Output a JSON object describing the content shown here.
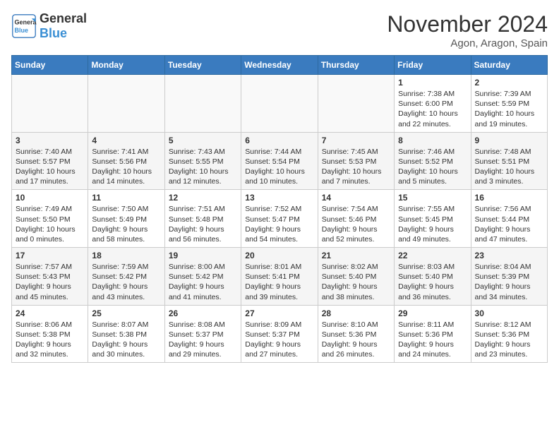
{
  "header": {
    "logo_line1": "General",
    "logo_line2": "Blue",
    "month": "November 2024",
    "location": "Agon, Aragon, Spain"
  },
  "weekdays": [
    "Sunday",
    "Monday",
    "Tuesday",
    "Wednesday",
    "Thursday",
    "Friday",
    "Saturday"
  ],
  "weeks": [
    [
      {
        "day": "",
        "content": ""
      },
      {
        "day": "",
        "content": ""
      },
      {
        "day": "",
        "content": ""
      },
      {
        "day": "",
        "content": ""
      },
      {
        "day": "",
        "content": ""
      },
      {
        "day": "1",
        "content": "Sunrise: 7:38 AM\nSunset: 6:00 PM\nDaylight: 10 hours and 22 minutes."
      },
      {
        "day": "2",
        "content": "Sunrise: 7:39 AM\nSunset: 5:59 PM\nDaylight: 10 hours and 19 minutes."
      }
    ],
    [
      {
        "day": "3",
        "content": "Sunrise: 7:40 AM\nSunset: 5:57 PM\nDaylight: 10 hours and 17 minutes."
      },
      {
        "day": "4",
        "content": "Sunrise: 7:41 AM\nSunset: 5:56 PM\nDaylight: 10 hours and 14 minutes."
      },
      {
        "day": "5",
        "content": "Sunrise: 7:43 AM\nSunset: 5:55 PM\nDaylight: 10 hours and 12 minutes."
      },
      {
        "day": "6",
        "content": "Sunrise: 7:44 AM\nSunset: 5:54 PM\nDaylight: 10 hours and 10 minutes."
      },
      {
        "day": "7",
        "content": "Sunrise: 7:45 AM\nSunset: 5:53 PM\nDaylight: 10 hours and 7 minutes."
      },
      {
        "day": "8",
        "content": "Sunrise: 7:46 AM\nSunset: 5:52 PM\nDaylight: 10 hours and 5 minutes."
      },
      {
        "day": "9",
        "content": "Sunrise: 7:48 AM\nSunset: 5:51 PM\nDaylight: 10 hours and 3 minutes."
      }
    ],
    [
      {
        "day": "10",
        "content": "Sunrise: 7:49 AM\nSunset: 5:50 PM\nDaylight: 10 hours and 0 minutes."
      },
      {
        "day": "11",
        "content": "Sunrise: 7:50 AM\nSunset: 5:49 PM\nDaylight: 9 hours and 58 minutes."
      },
      {
        "day": "12",
        "content": "Sunrise: 7:51 AM\nSunset: 5:48 PM\nDaylight: 9 hours and 56 minutes."
      },
      {
        "day": "13",
        "content": "Sunrise: 7:52 AM\nSunset: 5:47 PM\nDaylight: 9 hours and 54 minutes."
      },
      {
        "day": "14",
        "content": "Sunrise: 7:54 AM\nSunset: 5:46 PM\nDaylight: 9 hours and 52 minutes."
      },
      {
        "day": "15",
        "content": "Sunrise: 7:55 AM\nSunset: 5:45 PM\nDaylight: 9 hours and 49 minutes."
      },
      {
        "day": "16",
        "content": "Sunrise: 7:56 AM\nSunset: 5:44 PM\nDaylight: 9 hours and 47 minutes."
      }
    ],
    [
      {
        "day": "17",
        "content": "Sunrise: 7:57 AM\nSunset: 5:43 PM\nDaylight: 9 hours and 45 minutes."
      },
      {
        "day": "18",
        "content": "Sunrise: 7:59 AM\nSunset: 5:42 PM\nDaylight: 9 hours and 43 minutes."
      },
      {
        "day": "19",
        "content": "Sunrise: 8:00 AM\nSunset: 5:42 PM\nDaylight: 9 hours and 41 minutes."
      },
      {
        "day": "20",
        "content": "Sunrise: 8:01 AM\nSunset: 5:41 PM\nDaylight: 9 hours and 39 minutes."
      },
      {
        "day": "21",
        "content": "Sunrise: 8:02 AM\nSunset: 5:40 PM\nDaylight: 9 hours and 38 minutes."
      },
      {
        "day": "22",
        "content": "Sunrise: 8:03 AM\nSunset: 5:40 PM\nDaylight: 9 hours and 36 minutes."
      },
      {
        "day": "23",
        "content": "Sunrise: 8:04 AM\nSunset: 5:39 PM\nDaylight: 9 hours and 34 minutes."
      }
    ],
    [
      {
        "day": "24",
        "content": "Sunrise: 8:06 AM\nSunset: 5:38 PM\nDaylight: 9 hours and 32 minutes."
      },
      {
        "day": "25",
        "content": "Sunrise: 8:07 AM\nSunset: 5:38 PM\nDaylight: 9 hours and 30 minutes."
      },
      {
        "day": "26",
        "content": "Sunrise: 8:08 AM\nSunset: 5:37 PM\nDaylight: 9 hours and 29 minutes."
      },
      {
        "day": "27",
        "content": "Sunrise: 8:09 AM\nSunset: 5:37 PM\nDaylight: 9 hours and 27 minutes."
      },
      {
        "day": "28",
        "content": "Sunrise: 8:10 AM\nSunset: 5:36 PM\nDaylight: 9 hours and 26 minutes."
      },
      {
        "day": "29",
        "content": "Sunrise: 8:11 AM\nSunset: 5:36 PM\nDaylight: 9 hours and 24 minutes."
      },
      {
        "day": "30",
        "content": "Sunrise: 8:12 AM\nSunset: 5:36 PM\nDaylight: 9 hours and 23 minutes."
      }
    ]
  ]
}
